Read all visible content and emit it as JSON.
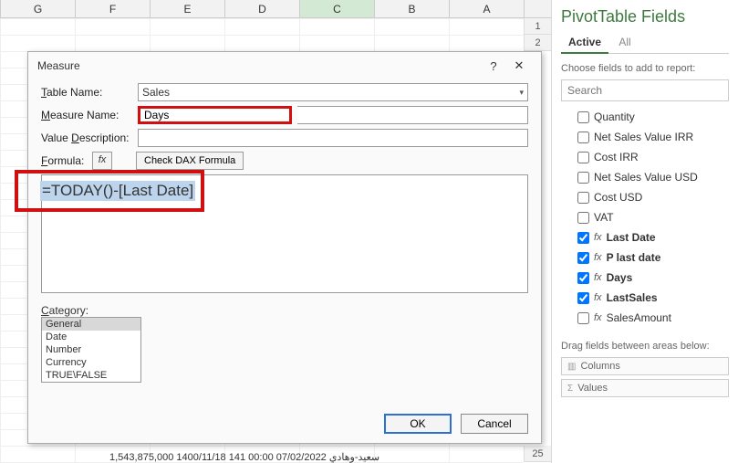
{
  "sheet": {
    "columns": [
      "G",
      "F",
      "E",
      "D",
      "C",
      "B",
      "A"
    ],
    "active_column": "C",
    "rows": [
      "1",
      "2",
      "25"
    ],
    "bottom_row": "سعيد-وهادي   07/02/2022 00:00   141 1400/11/18   1,543,875,000"
  },
  "panel": {
    "title": "PivotTable Fields",
    "tabs": {
      "active": "Active",
      "all": "All"
    },
    "hint": "Choose fields to add to report:",
    "search_placeholder": "Search",
    "fields": [
      {
        "label": "Quantity",
        "checked": false,
        "fx": false,
        "bold": false
      },
      {
        "label": "Net Sales Value IRR",
        "checked": false,
        "fx": false,
        "bold": false
      },
      {
        "label": "Cost IRR",
        "checked": false,
        "fx": false,
        "bold": false
      },
      {
        "label": "Net Sales Value USD",
        "checked": false,
        "fx": false,
        "bold": false
      },
      {
        "label": "Cost USD",
        "checked": false,
        "fx": false,
        "bold": false
      },
      {
        "label": "VAT",
        "checked": false,
        "fx": false,
        "bold": false
      },
      {
        "label": "Last Date",
        "checked": true,
        "fx": true,
        "bold": true
      },
      {
        "label": "P last date",
        "checked": true,
        "fx": true,
        "bold": true
      },
      {
        "label": "Days",
        "checked": true,
        "fx": true,
        "bold": true
      },
      {
        "label": "LastSales",
        "checked": true,
        "fx": true,
        "bold": true
      },
      {
        "label": "SalesAmount",
        "checked": false,
        "fx": true,
        "bold": false
      }
    ],
    "drag_hint": "Drag fields between areas below:",
    "areas": {
      "columns": "Columns",
      "values": "Values"
    }
  },
  "dialog": {
    "title": "Measure",
    "help_icon": "?",
    "close_icon": "✕",
    "labels": {
      "table_name": "Table Name:",
      "measure_name": "Measure Name:",
      "value_desc": "Value Description:",
      "formula": "Formula:",
      "check_dax": "Check DAX Formula",
      "category": "Category:",
      "ok": "OK",
      "cancel": "Cancel"
    },
    "fx_label": "fx",
    "values": {
      "table_name": "Sales",
      "measure_name": "Days",
      "value_desc": "",
      "formula": "=TODAY()-[Last Date]"
    },
    "categories": [
      "General",
      "Date",
      "Number",
      "Currency",
      "TRUE\\FALSE"
    ],
    "selected_category": "General"
  }
}
